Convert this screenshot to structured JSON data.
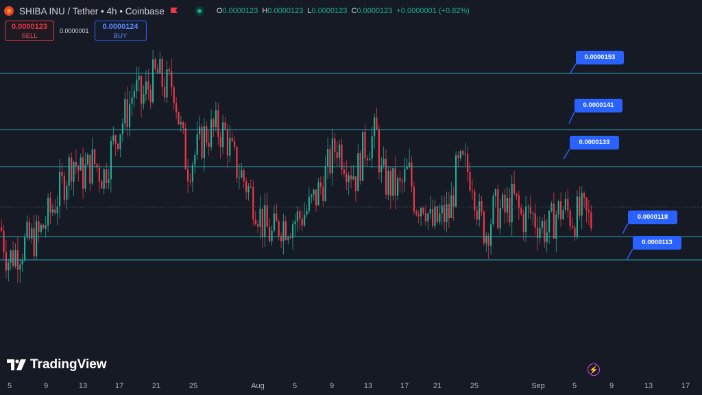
{
  "header": {
    "title": "SHIBA INU / Tether • 4h • Coinbase",
    "ohlc": [
      {
        "k": "O",
        "v": "0.0000123"
      },
      {
        "k": "H",
        "v": "0.0000123"
      },
      {
        "k": "L",
        "v": "0.0000123"
      },
      {
        "k": "C",
        "v": "0.0000123"
      },
      {
        "k": "",
        "v": "+0.0000001 (+0.82%)"
      }
    ]
  },
  "trade": {
    "sell_price": "0.0000123",
    "sell_label": "SELL",
    "spread": "0.0000001",
    "buy_price": "0.0000124",
    "buy_label": "BUY"
  },
  "levels": [
    "0.0000153",
    "0.0000141",
    "0.0000133",
    "0.0000118",
    "0.0000113"
  ],
  "watermark": "TradingView",
  "xaxis": [
    "5",
    "9",
    "13",
    "17",
    "21",
    "25",
    "Aug",
    "5",
    "9",
    "13",
    "17",
    "21",
    "25",
    "Sep",
    "5",
    "9",
    "13",
    "17"
  ],
  "colors": {
    "up": "#22ab94",
    "down": "#f23645",
    "line": "#2aa6b8",
    "tag": "#2962ff",
    "background": "#161a25"
  },
  "chart_data": {
    "type": "candlestick",
    "title": "SHIBA INU / Tether • 4h • Coinbase",
    "ylim": [
      1.05e-05,
      1.62e-05
    ],
    "horizontal_levels": [
      1.53e-05,
      1.41e-05,
      1.33e-05,
      1.18e-05,
      1.13e-05
    ],
    "x_tick_labels": [
      "5",
      "9",
      "13",
      "17",
      "21",
      "25",
      "Aug",
      "5",
      "9",
      "13",
      "17",
      "21",
      "25",
      "Sep",
      "5",
      "9",
      "13",
      "17"
    ],
    "close_path": [
      [
        0,
        1.2e-05
      ],
      [
        10,
        1.13e-05
      ],
      [
        25,
        1.15e-05
      ],
      [
        40,
        1.17e-05
      ],
      [
        55,
        1.18e-05
      ],
      [
        75,
        1.24e-05
      ],
      [
        90,
        1.29e-05
      ],
      [
        105,
        1.35e-05
      ],
      [
        118,
        1.31e-05
      ],
      [
        135,
        1.34e-05
      ],
      [
        150,
        1.31e-05
      ],
      [
        160,
        1.36e-05
      ],
      [
        172,
        1.41e-05
      ],
      [
        185,
        1.45e-05
      ],
      [
        195,
        1.5e-05
      ],
      [
        205,
        1.47e-05
      ],
      [
        215,
        1.5e-05
      ],
      [
        228,
        1.53e-05
      ],
      [
        240,
        1.5e-05
      ],
      [
        252,
        1.51e-05
      ],
      [
        262,
        1.41e-05
      ],
      [
        272,
        1.33e-05
      ],
      [
        285,
        1.36e-05
      ],
      [
        298,
        1.4e-05
      ],
      [
        315,
        1.41e-05
      ],
      [
        328,
        1.4e-05
      ],
      [
        340,
        1.34e-05
      ],
      [
        352,
        1.31e-05
      ],
      [
        362,
        1.28e-05
      ],
      [
        372,
        1.25e-05
      ],
      [
        382,
        1.21e-05
      ],
      [
        395,
        1.18e-05
      ],
      [
        408,
        1.21e-05
      ],
      [
        420,
        1.21e-05
      ],
      [
        435,
        1.22e-05
      ],
      [
        450,
        1.24e-05
      ],
      [
        465,
        1.28e-05
      ],
      [
        478,
        1.33e-05
      ],
      [
        490,
        1.38e-05
      ],
      [
        505,
        1.34e-05
      ],
      [
        518,
        1.31e-05
      ],
      [
        530,
        1.37e-05
      ],
      [
        548,
        1.4e-05
      ],
      [
        555,
        1.31e-05
      ],
      [
        568,
        1.29e-05
      ],
      [
        582,
        1.28e-05
      ],
      [
        595,
        1.32e-05
      ],
      [
        605,
        1.25e-05
      ],
      [
        618,
        1.26e-05
      ],
      [
        628,
        1.2e-05
      ],
      [
        642,
        1.22e-05
      ],
      [
        655,
        1.23e-05
      ],
      [
        665,
        1.32e-05
      ],
      [
        675,
        1.33e-05
      ],
      [
        688,
        1.31e-05
      ],
      [
        698,
        1.22e-05
      ],
      [
        708,
        1.19e-05
      ],
      [
        720,
        1.24e-05
      ],
      [
        735,
        1.23e-05
      ],
      [
        748,
        1.26e-05
      ],
      [
        760,
        1.22e-05
      ],
      [
        772,
        1.23e-05
      ],
      [
        785,
        1.21e-05
      ],
      [
        798,
        1.19e-05
      ],
      [
        810,
        1.23e-05
      ],
      [
        822,
        1.24e-05
      ],
      [
        835,
        1.22e-05
      ],
      [
        848,
        1.23e-05
      ],
      [
        862,
        1.21e-05
      ]
    ]
  }
}
